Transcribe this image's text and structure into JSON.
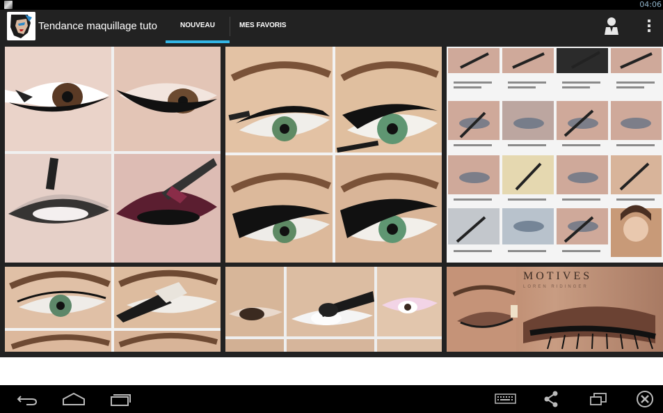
{
  "status_bar": {
    "time": "04:06"
  },
  "action_bar": {
    "app_title": "Tendance maquillage tuto",
    "tabs": [
      {
        "label": "NOUVEAU",
        "selected": true
      },
      {
        "label": "MES FAVORIS",
        "selected": false
      }
    ],
    "accent_color": "#33b5e5",
    "actions": [
      "profile-icon",
      "overflow-menu-icon"
    ]
  },
  "gallery": {
    "tiles": [
      {
        "subject": "four-step black winged eyeliner tutorial"
      },
      {
        "subject": "four-step black cat eye tutorial, green eyes"
      },
      {
        "subject": "multi-step smoky eye collage with captions"
      },
      {
        "subject": "eyeliner and brush application, green eye"
      },
      {
        "subject": "numbered steps white and pink shadow"
      },
      {
        "subject": "brown smoky eye with MOTIVES brand text",
        "brand_text": "MOTIVES",
        "brand_subtext": "LOREN RIDINGER"
      }
    ]
  },
  "nav_bar": {
    "buttons": [
      "back-icon",
      "home-icon",
      "recent-apps-icon",
      "keyboard-icon",
      "share-icon",
      "window-icon",
      "close-icon"
    ]
  }
}
